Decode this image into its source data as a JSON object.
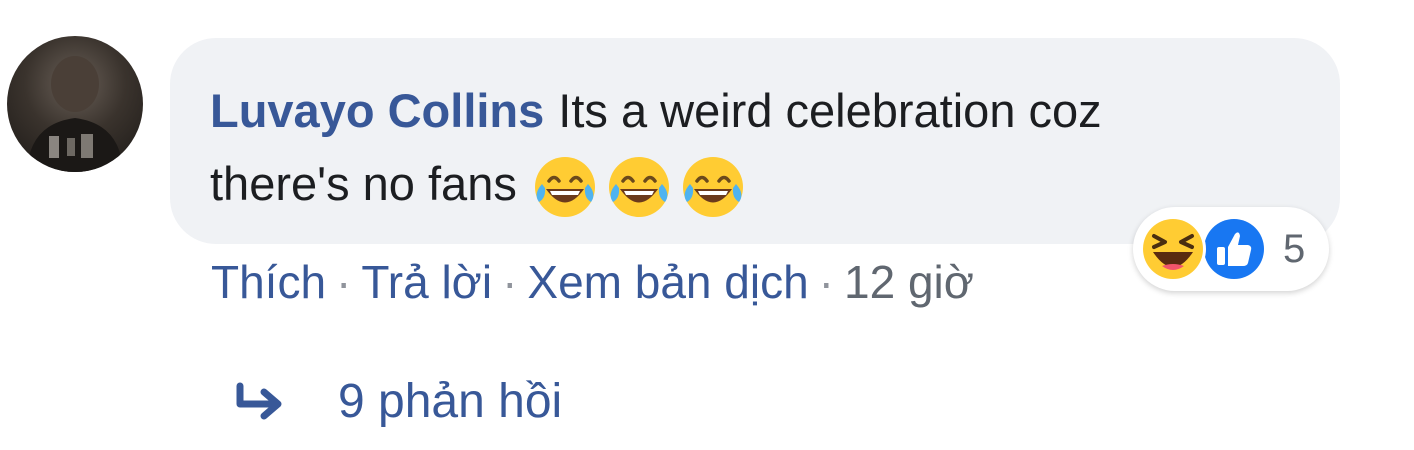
{
  "comment": {
    "author": "Luvayo Collins",
    "text_line1": "Its a weird celebration coz",
    "text_line2": "there's no fans",
    "emojis": [
      "face-with-tears-of-joy-icon",
      "face-with-tears-of-joy-icon",
      "face-with-tears-of-joy-icon"
    ]
  },
  "actions": {
    "like": "Thích",
    "reply": "Trả lời",
    "translate": "Xem bản dịch",
    "separator": "·",
    "time": "12 giờ"
  },
  "reactions": {
    "icons": [
      "haha-reaction-icon",
      "like-reaction-icon"
    ],
    "count": "5"
  },
  "replies": {
    "icon": "reply-arrow-icon",
    "label": "9 phản hồi"
  },
  "colors": {
    "link": "#385898",
    "bubble": "#f0f2f5",
    "text": "#1c1e21",
    "meta": "#606770",
    "like_blue": "#1877f2",
    "emoji_yellow": "#ffcc33"
  }
}
